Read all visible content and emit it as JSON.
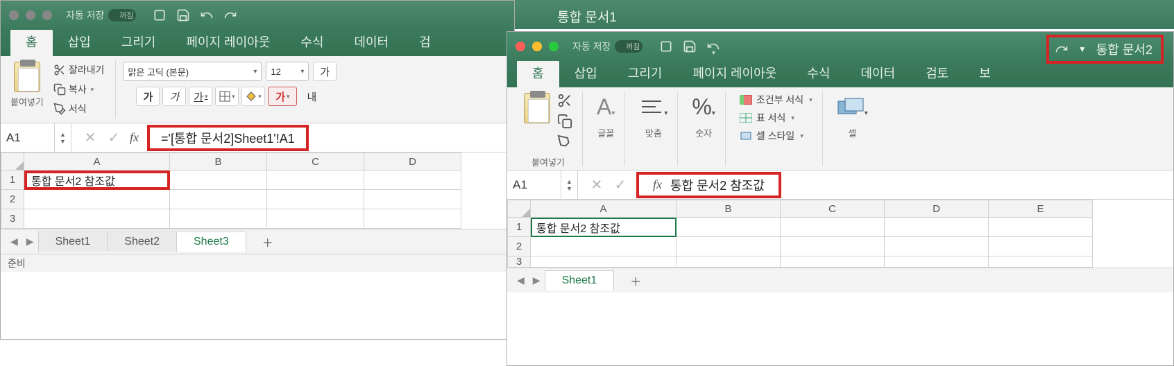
{
  "window1": {
    "title": "통합 문서1",
    "autosave_label": "자동 저장",
    "autosave_state": "꺼짐",
    "tabs": {
      "home": "홈",
      "insert": "삽입",
      "draw": "그리기",
      "layout": "페이지 레이아웃",
      "formulas": "수식",
      "data": "데이터",
      "review_partial": "검"
    },
    "clipboard": {
      "paste": "붙여넣기",
      "cut": "잘라내기",
      "copy": "복사",
      "format": "서식"
    },
    "font": {
      "name": "맑은 고딕 (본문)",
      "size": "12",
      "enlarge": "가",
      "bold": "가",
      "italic": "가",
      "underline": "가",
      "intext": "내"
    },
    "namebox": "A1",
    "formula": "='[통합 문서2]Sheet1'!A1",
    "cols": {
      "A": "A",
      "B": "B",
      "C": "C",
      "D": "D"
    },
    "cell_a1": "통합 문서2 참조값",
    "sheets": {
      "s1": "Sheet1",
      "s2": "Sheet2",
      "s3": "Sheet3"
    },
    "status": "준비"
  },
  "window2": {
    "title": "통합 문서2",
    "autosave_label": "자동 저장",
    "autosave_state": "꺼짐",
    "tabs": {
      "home": "홈",
      "insert": "삽입",
      "draw": "그리기",
      "layout": "페이지 레이아웃",
      "formulas": "수식",
      "data": "데이터",
      "review": "검토",
      "view_partial": "보"
    },
    "groups": {
      "paste": "붙여넣기",
      "font": "글꼴",
      "align": "맞춤",
      "number": "숫자",
      "cell": "셀"
    },
    "styles": {
      "cond": "조건부 서식",
      "table": "표 서식",
      "cell": "셀 스타일"
    },
    "namebox": "A1",
    "formula": "통합 문서2 참조값",
    "cols": {
      "A": "A",
      "B": "B",
      "C": "C",
      "D": "D",
      "E": "E"
    },
    "cell_a1": "통합 문서2 참조값",
    "sheets": {
      "s1": "Sheet1"
    }
  }
}
